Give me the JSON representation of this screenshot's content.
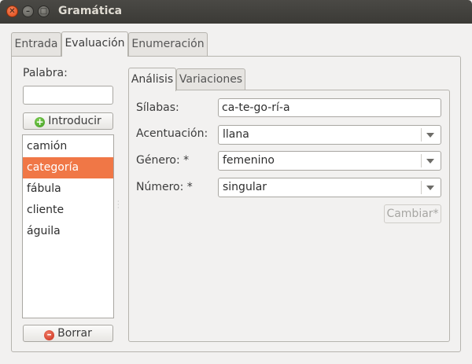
{
  "window": {
    "title": "Gramática"
  },
  "tabs": [
    {
      "label": "Entrada",
      "active": false
    },
    {
      "label": "Evaluación",
      "active": true
    },
    {
      "label": "Enumeración",
      "active": false
    }
  ],
  "left": {
    "word_label": "Palabra:",
    "word_value": "",
    "add_label": "Introducir",
    "delete_label": "Borrar",
    "words": [
      "camión",
      "categoría",
      "fábula",
      "cliente",
      "águila"
    ],
    "selected_index": 1
  },
  "inner_tabs": [
    {
      "label": "Análisis",
      "active": true
    },
    {
      "label": "Variaciones",
      "active": false
    }
  ],
  "form": {
    "syllables_label": "Sílabas:",
    "syllables_value": "ca-te-go-rí-a",
    "accent_label": "Acentuación:",
    "accent_value": "llana",
    "gender_label": "Género: *",
    "gender_value": "femenino",
    "number_label": "Número: *",
    "number_value": "singular",
    "change_label": "Cambiar*"
  },
  "colors": {
    "selection": "#f07746",
    "titlebar": "#3b3a36"
  }
}
